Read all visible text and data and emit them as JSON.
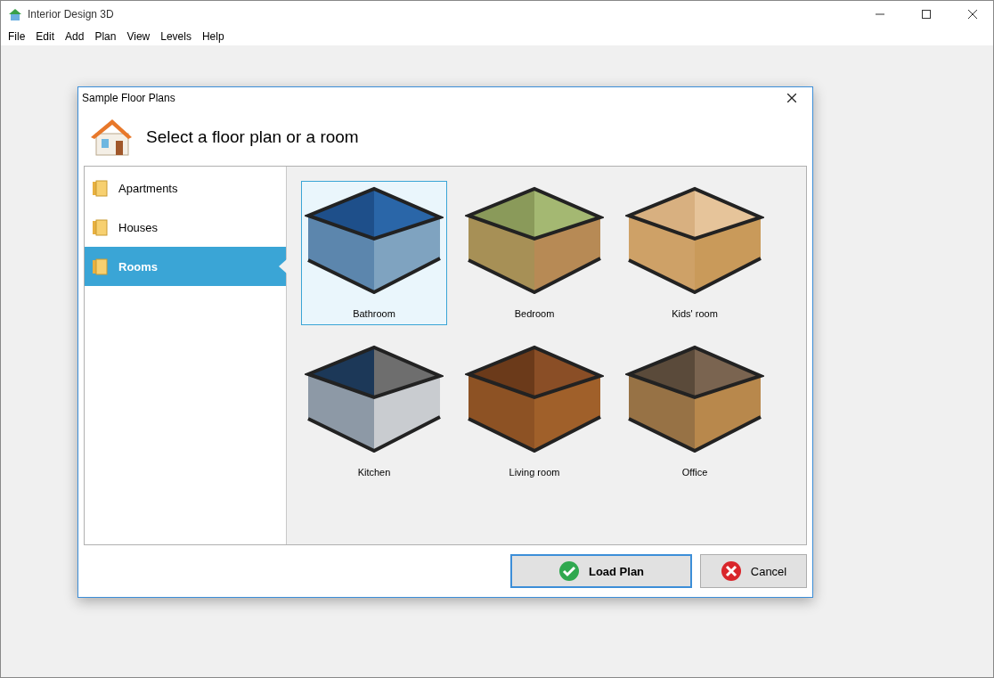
{
  "window": {
    "title": "Interior Design 3D"
  },
  "menu": [
    "File",
    "Edit",
    "Add",
    "Plan",
    "View",
    "Levels",
    "Help"
  ],
  "dialog": {
    "title": "Sample Floor Plans",
    "heading": "Select a floor plan or a room"
  },
  "categories": [
    {
      "label": "Apartments",
      "selected": false
    },
    {
      "label": "Houses",
      "selected": false
    },
    {
      "label": "Rooms",
      "selected": true
    }
  ],
  "plans": [
    {
      "label": "Bathroom",
      "selected": true
    },
    {
      "label": "Bedroom",
      "selected": false
    },
    {
      "label": "Kids' room",
      "selected": false
    },
    {
      "label": "Kitchen",
      "selected": false
    },
    {
      "label": "Living room",
      "selected": false
    },
    {
      "label": "Office",
      "selected": false
    }
  ],
  "buttons": [
    {
      "label": "Load Plan",
      "kind": "primary"
    },
    {
      "label": "Cancel",
      "kind": "cancel"
    }
  ]
}
